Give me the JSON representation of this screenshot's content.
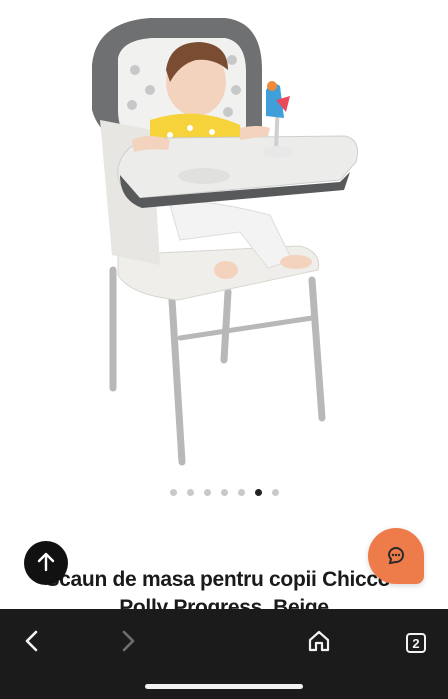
{
  "product": {
    "title": "Scaun de masa pentru copii Chicco - Polly Progress, Beige",
    "image_alt": "Chicco Polly Progress high chair with baby",
    "carousel": {
      "total": 7,
      "active": 6
    }
  },
  "fab": {
    "scroll_top_icon": "arrow-up-icon",
    "chat_icon": "chat-bubble-icon",
    "chat_color": "#ee7b4a"
  },
  "browser": {
    "back_icon": "chevron-left-icon",
    "forward_icon": "chevron-right-icon",
    "home_icon": "home-icon",
    "tab_count": "2",
    "background": "#1b1b1b"
  }
}
